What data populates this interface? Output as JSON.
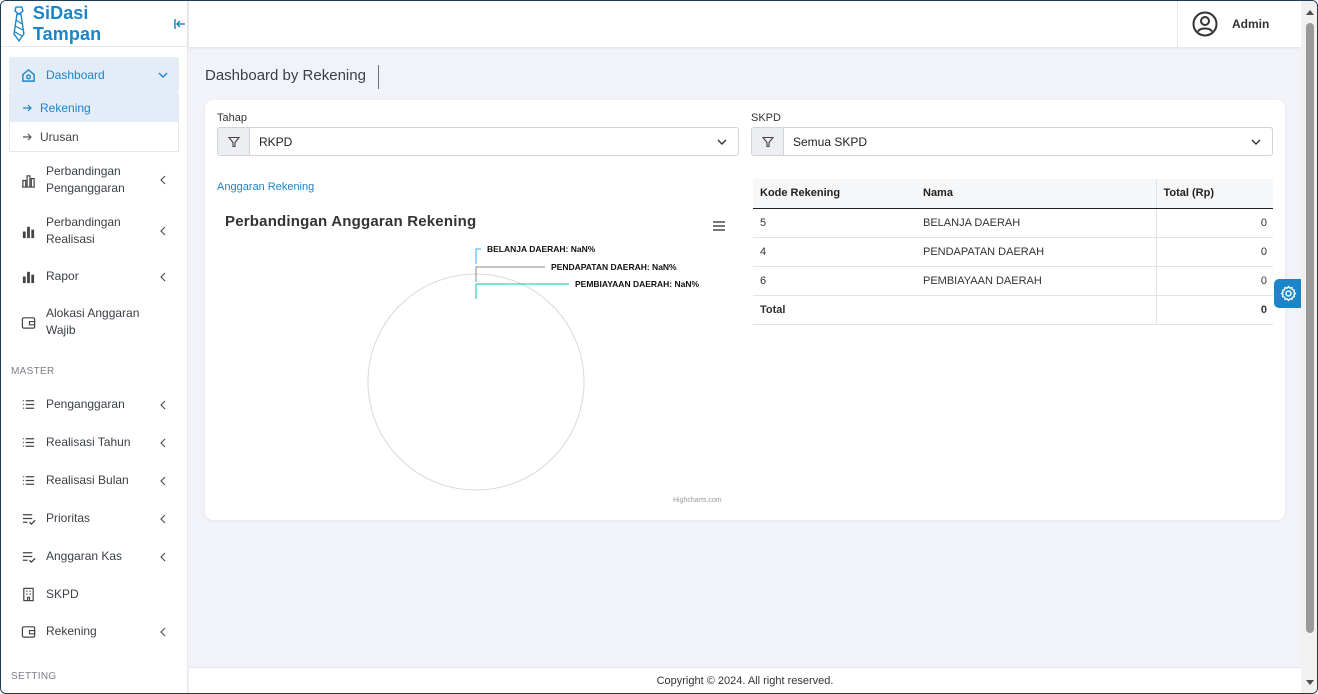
{
  "brand": {
    "name": "SiDasi Tampan"
  },
  "header": {
    "user_name": "Admin"
  },
  "sidebar": {
    "dashboard_label": "Dashboard",
    "dashboard_sub": [
      "Rekening",
      "Urusan"
    ],
    "items": [
      {
        "label": "Perbandingan Penganggaran",
        "icon": "bar-chart-outline-icon"
      },
      {
        "label": "Perbandingan Realisasi",
        "icon": "bar-chart-icon"
      },
      {
        "label": "Rapor",
        "icon": "bar-chart-icon"
      },
      {
        "label": "Alokasi Anggaran Wajib",
        "icon": "wallet-icon"
      }
    ],
    "master_label": "MASTER",
    "master_items": [
      {
        "label": "Penganggaran",
        "icon": "list-icon"
      },
      {
        "label": "Realisasi Tahun",
        "icon": "list-icon"
      },
      {
        "label": "Realisasi Bulan",
        "icon": "list-icon"
      },
      {
        "label": "Prioritas",
        "icon": "checklist-icon"
      },
      {
        "label": "Anggaran Kas",
        "icon": "checklist-icon"
      },
      {
        "label": "SKPD",
        "icon": "building-icon"
      },
      {
        "label": "Rekening",
        "icon": "wallet-icon"
      }
    ],
    "setting_label": "SETTING"
  },
  "page": {
    "title": "Dashboard by Rekening"
  },
  "filters": {
    "tahap_label": "Tahap",
    "tahap_value": "RKPD",
    "skpd_label": "SKPD",
    "skpd_value": "Semua SKPD"
  },
  "chart_link": "Anggaran Rekening",
  "chart_data": {
    "type": "pie",
    "title": "Perbandingan Anggaran Rekening",
    "slices": [
      {
        "label": "BELANJA DAERAH: NaN%",
        "value": 0
      },
      {
        "label": "PENDAPATAN DAERAH: NaN%",
        "value": 0
      },
      {
        "label": "PEMBIAYAAN DAERAH: NaN%",
        "value": 0
      }
    ],
    "credits": "Highcharts.com",
    "colors": [
      "#2caffe",
      "#544fc5",
      "#00e272"
    ]
  },
  "table": {
    "headers": [
      "Kode Rekening",
      "Nama",
      "Total (Rp)"
    ],
    "rows": [
      {
        "kode": "5",
        "nama": "BELANJA DAERAH",
        "total": "0"
      },
      {
        "kode": "4",
        "nama": "PENDAPATAN DAERAH",
        "total": "0"
      },
      {
        "kode": "6",
        "nama": "PEMBIAYAAN DAERAH",
        "total": "0"
      }
    ],
    "total_label": "Total",
    "total_value": "0"
  },
  "footer": {
    "text": "Copyright © 2024. All right reserved."
  },
  "colors": {
    "accent": "#1c84c9",
    "active_bg": "#e3ecf7"
  }
}
